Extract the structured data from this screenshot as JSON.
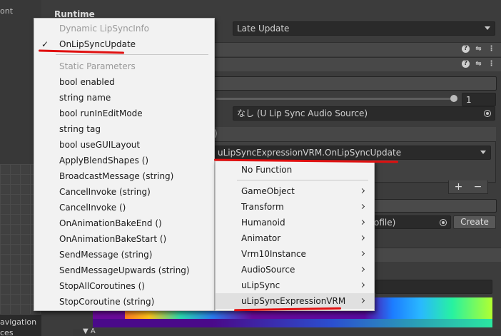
{
  "left_panel": {
    "cut_label": "ont",
    "nav_label_1": "avigation",
    "nav_label_2": "ces"
  },
  "inspector": {
    "runtime_heading": "Runtime",
    "update_method_value": "Late Update",
    "slider_value": "1",
    "audio_source_value": "なし (U Lip Sync Audio Source)",
    "event_title": ")",
    "event_function_value": "uLipSyncExpressionVRM.OnLipSyncUpdate",
    "plus_label": "+",
    "minus_label": "−",
    "profile_value": "ofile)",
    "create_button": "Create",
    "footer_label": "▼ A"
  },
  "function_menu": {
    "dynamic_header": "Dynamic LipSyncInfo",
    "checked_item": "OnLipSyncUpdate",
    "static_header": "Static Parameters",
    "items": [
      "bool enabled",
      "string name",
      "bool runInEditMode",
      "string tag",
      "bool useGUILayout",
      "ApplyBlendShapes ()",
      "BroadcastMessage (string)",
      "CancelInvoke (string)",
      "CancelInvoke ()",
      "OnAnimationBakeEnd ()",
      "OnAnimationBakeStart ()",
      "SendMessage (string)",
      "SendMessageUpwards (string)",
      "StopAllCoroutines ()",
      "StopCoroutine (string)"
    ]
  },
  "component_menu": {
    "no_function": "No Function",
    "items": [
      "GameObject",
      "Transform",
      "Humanoid",
      "Animator",
      "Vrm10Instance",
      "AudioSource",
      "uLipSync",
      "uLipSyncExpressionVRM"
    ]
  },
  "colors": {
    "annotation_red": "#e01010",
    "menu_bg": "#f2f2f2",
    "inspector_bg": "#3c3c3c"
  }
}
